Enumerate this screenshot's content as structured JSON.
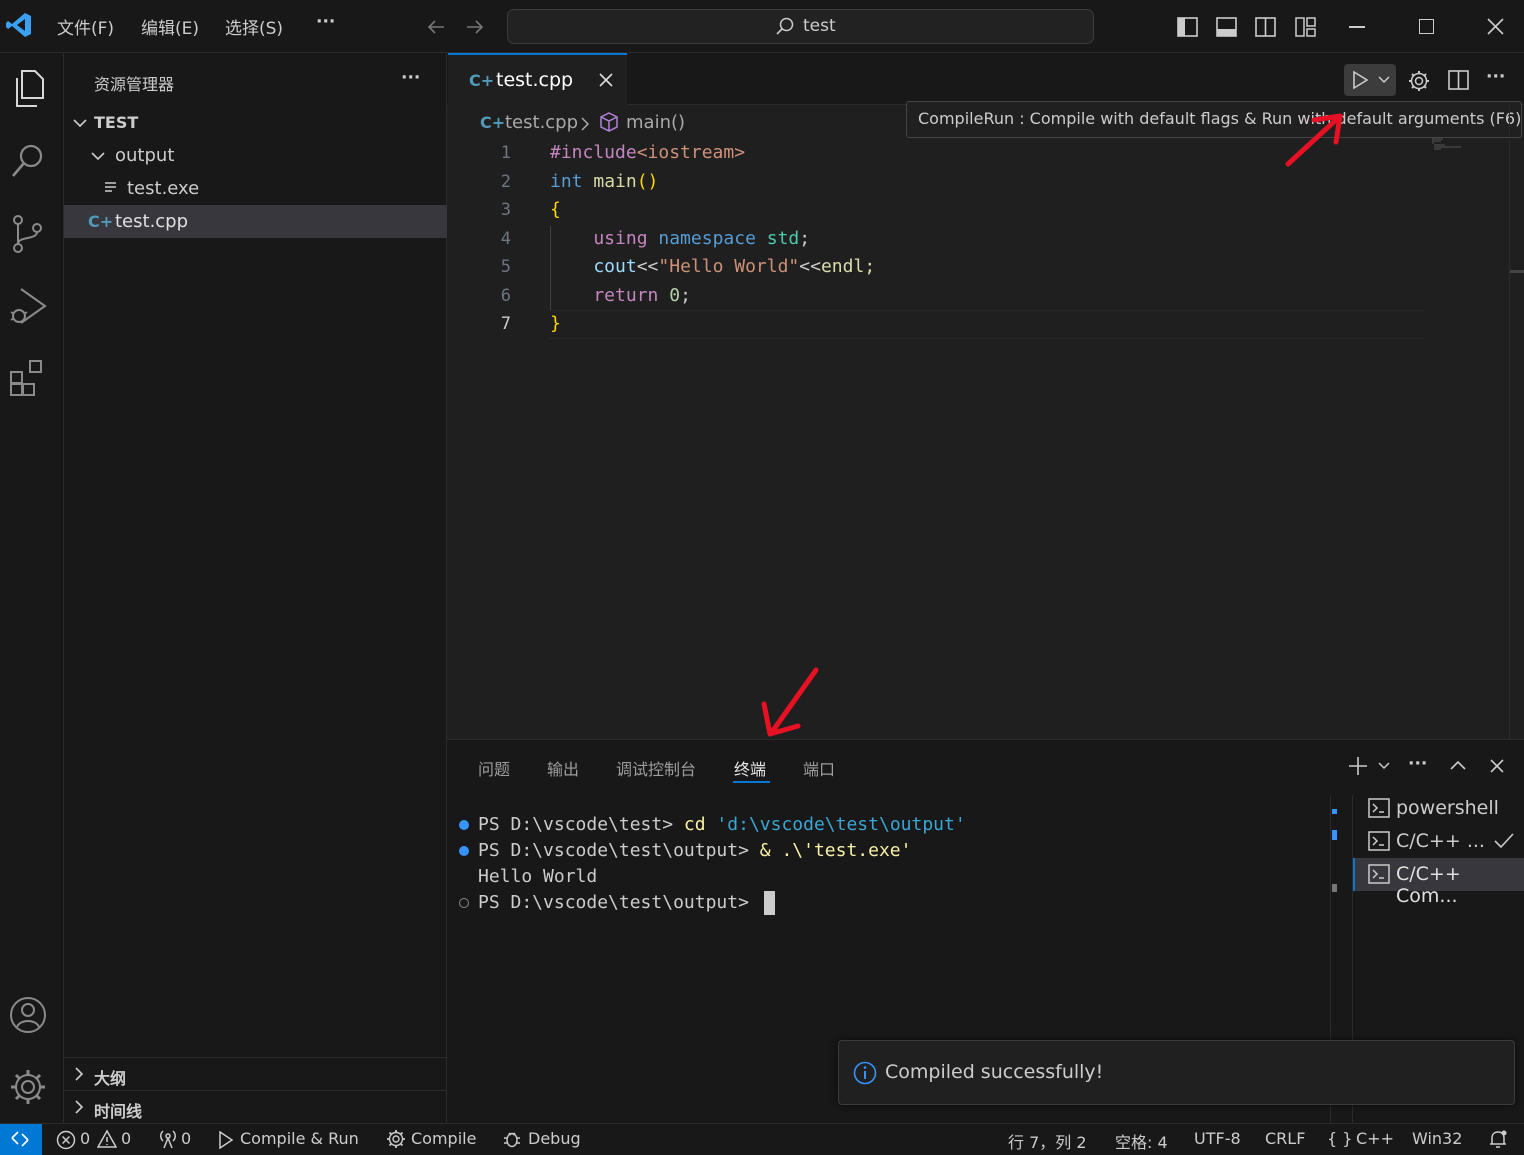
{
  "title_bar": {
    "menus": [
      "文件(F)",
      "编辑(E)",
      "选择(S)"
    ],
    "more": "···",
    "search_text": "test"
  },
  "sidebar": {
    "title": "资源管理器",
    "more": "···",
    "folder": "TEST",
    "tree": [
      {
        "label": "output",
        "type": "folder"
      },
      {
        "label": "test.exe",
        "type": "file"
      },
      {
        "label": "test.cpp",
        "type": "cpp",
        "selected": true
      }
    ],
    "outline": "大纲",
    "timeline": "时间线"
  },
  "editor": {
    "tab_label": "test.cpp",
    "breadcrumb_file": "test.cpp",
    "breadcrumb_symbol": "main()",
    "tooltip": "CompileRun : Compile with default flags & Run with default arguments (F6)",
    "line_numbers": [
      "1",
      "2",
      "3",
      "4",
      "5",
      "6",
      "7"
    ],
    "lines": [
      {
        "t1": "#include",
        "t2": "<iostream>",
        "t3": "",
        "t4": "",
        "t5": ""
      },
      {
        "t1": "int",
        "t2": " main",
        "t3": "()",
        "t4": "",
        "t5": ""
      },
      {
        "t1": "{",
        "t2": "",
        "t3": "",
        "t4": "",
        "t5": ""
      },
      {
        "t1": "    using",
        "t2": " namespace",
        "t3": " std",
        "t4": ";",
        "t5": ""
      },
      {
        "t1": "    cout",
        "t2": "<<",
        "t3": "\"Hello World\"",
        "t4": "<<",
        "t5": "endl;"
      },
      {
        "t1": "    return",
        "t2": " 0",
        "t3": ";",
        "t4": "",
        "t5": ""
      },
      {
        "t1": "}",
        "t2": "",
        "t3": "",
        "t4": "",
        "t5": ""
      }
    ]
  },
  "panel": {
    "tabs": [
      "问题",
      "输出",
      "调试控制台",
      "终端",
      "端口"
    ],
    "active_tab": "终端",
    "terminal": [
      {
        "prompt": "PS D:\\vscode\\test> ",
        "cmd": "cd",
        "arg": " 'd:\\vscode\\test\\output'"
      },
      {
        "prompt": "PS D:\\vscode\\test\\output> ",
        "cmd": "& .\\'test.exe'",
        "arg": ""
      },
      {
        "prompt": "Hello World",
        "cmd": "",
        "arg": ""
      },
      {
        "prompt": "PS D:\\vscode\\test\\output> ",
        "cmd": "",
        "arg": ""
      }
    ],
    "terminal_list": [
      "powershell",
      "C/C++ ...",
      "C/C++ Com..."
    ]
  },
  "notification": {
    "text": "Compiled successfully!"
  },
  "status_bar": {
    "errors": "0",
    "warnings": "0",
    "ports": "0",
    "compile_run": "Compile & Run",
    "compile": "Compile",
    "debug": "Debug",
    "position": "行 7，列 2",
    "spaces": "空格: 4",
    "encoding": "UTF-8",
    "eol": "CRLF",
    "language": "C++",
    "platform": "Win32"
  },
  "colors": {
    "accent": "#0078d4",
    "keyword": "#569cd6",
    "control": "#c586c0",
    "string": "#ce9178",
    "function": "#dcdcaa",
    "annotation": "#e81123"
  }
}
